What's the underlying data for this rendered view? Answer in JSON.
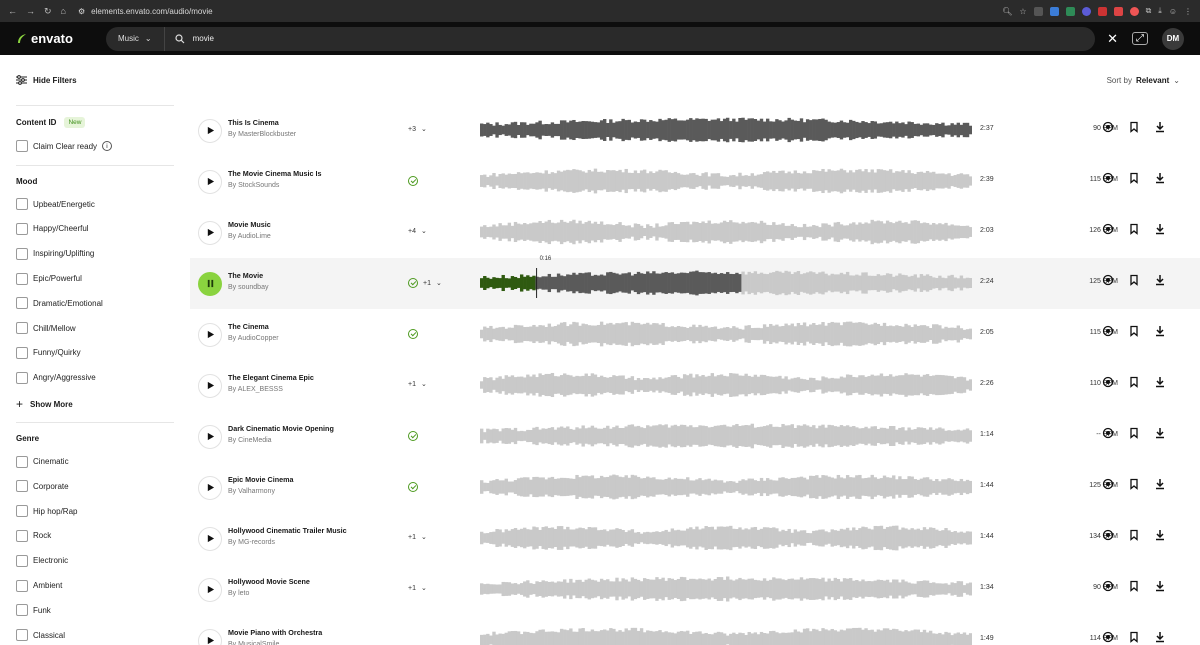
{
  "browser": {
    "url": "elements.envato.com/audio/movie"
  },
  "header": {
    "logo": "envato",
    "category": "Music",
    "search_value": "movie",
    "avatar": "DM"
  },
  "sidebar": {
    "hide_filters": "Hide Filters",
    "content_id": {
      "title": "Content ID",
      "badge": "New",
      "items": [
        "Claim Clear ready"
      ]
    },
    "mood": {
      "title": "Mood",
      "items": [
        "Upbeat/Energetic",
        "Happy/Cheerful",
        "Inspiring/Uplifting",
        "Epic/Powerful",
        "Dramatic/Emotional",
        "Chill/Mellow",
        "Funny/Quirky",
        "Angry/Aggressive"
      ],
      "show_more": "Show More"
    },
    "genre": {
      "title": "Genre",
      "items": [
        "Cinematic",
        "Corporate",
        "Hip hop/Rap",
        "Rock",
        "Electronic",
        "Ambient",
        "Funk",
        "Classical"
      ]
    }
  },
  "sort": {
    "prefix": "Sort by",
    "value": "Relevant"
  },
  "playing_time": "0:16",
  "colors": {
    "accent": "#8ad33f",
    "check_green": "#4d9a1f",
    "wave_played": "#5a5a5a",
    "wave_unplayed": "#c9c9c9"
  },
  "tracks": [
    {
      "title": "This Is Cinema",
      "author": "By MasterBlockbuster",
      "extra": "+3",
      "cid": false,
      "duration": "2:37",
      "bpm": "90 BPM",
      "state": "played"
    },
    {
      "title": "The Movie Cinema Music Is",
      "author": "By StockSounds",
      "extra": "",
      "cid": true,
      "duration": "2:39",
      "bpm": "115 BPM",
      "state": "idle"
    },
    {
      "title": "Movie Music",
      "author": "By AudioLime",
      "extra": "+4",
      "cid": false,
      "duration": "2:03",
      "bpm": "126 BPM",
      "state": "idle"
    },
    {
      "title": "The Movie",
      "author": "By soundbay",
      "extra": "+1",
      "cid": true,
      "duration": "2:24",
      "bpm": "125 BPM",
      "state": "playing"
    },
    {
      "title": "The Cinema",
      "author": "By AudioCopper",
      "extra": "",
      "cid": true,
      "duration": "2:05",
      "bpm": "115 BPM",
      "state": "idle"
    },
    {
      "title": "The Elegant Cinema Epic",
      "author": "By ALEX_BESSS",
      "extra": "+1",
      "cid": false,
      "duration": "2:26",
      "bpm": "110 BPM",
      "state": "idle"
    },
    {
      "title": "Dark Cinematic Movie Opening",
      "author": "By CineMedia",
      "extra": "",
      "cid": true,
      "duration": "1:14",
      "bpm": "-- BPM",
      "state": "idle"
    },
    {
      "title": "Epic Movie Cinema",
      "author": "By Valharmony",
      "extra": "",
      "cid": true,
      "duration": "1:44",
      "bpm": "125 BPM",
      "state": "idle"
    },
    {
      "title": "Hollywood Cinematic Trailer Music",
      "author": "By MG-records",
      "extra": "+1",
      "cid": false,
      "duration": "1:44",
      "bpm": "134 BPM",
      "state": "idle"
    },
    {
      "title": "Hollywood Movie Scene",
      "author": "By leto",
      "extra": "+1",
      "cid": false,
      "duration": "1:34",
      "bpm": "90 BPM",
      "state": "idle"
    },
    {
      "title": "Movie Piano with Orchestra",
      "author": "By MusicalSmile",
      "extra": "",
      "cid": false,
      "duration": "1:49",
      "bpm": "114 BPM",
      "state": "idle"
    }
  ]
}
